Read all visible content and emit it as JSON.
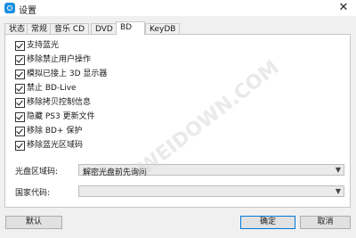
{
  "window": {
    "title": "设置",
    "icon": "app-logo-icon"
  },
  "tabs": [
    {
      "label": "状态",
      "active": false
    },
    {
      "label": "常规",
      "active": false
    },
    {
      "label": "音乐 CD",
      "active": false
    },
    {
      "label": "DVD",
      "active": false
    },
    {
      "label": "BD",
      "active": true
    },
    {
      "label": "KeyDB",
      "active": false
    }
  ],
  "options": [
    {
      "label": "支持蓝光",
      "checked": true
    },
    {
      "label": "移除禁止用户操作",
      "checked": true
    },
    {
      "label": "模拟已接上 3D 显示器",
      "checked": true
    },
    {
      "label": "禁止 BD-Live",
      "checked": true
    },
    {
      "label": "移除拷贝控制信息",
      "checked": true
    },
    {
      "label": "隐藏 PS3 更新文件",
      "checked": true
    },
    {
      "label": "移除 BD+ 保护",
      "checked": true
    },
    {
      "label": "移除蓝光区域码",
      "checked": true
    }
  ],
  "region": {
    "label": "光盘区域码:",
    "value": "解密光盘前先询问"
  },
  "country": {
    "label": "国家代码:",
    "value": ""
  },
  "buttons": {
    "default": "默认",
    "ok": "确定",
    "cancel": "取消"
  },
  "watermark": "WEIDOWN.COM"
}
